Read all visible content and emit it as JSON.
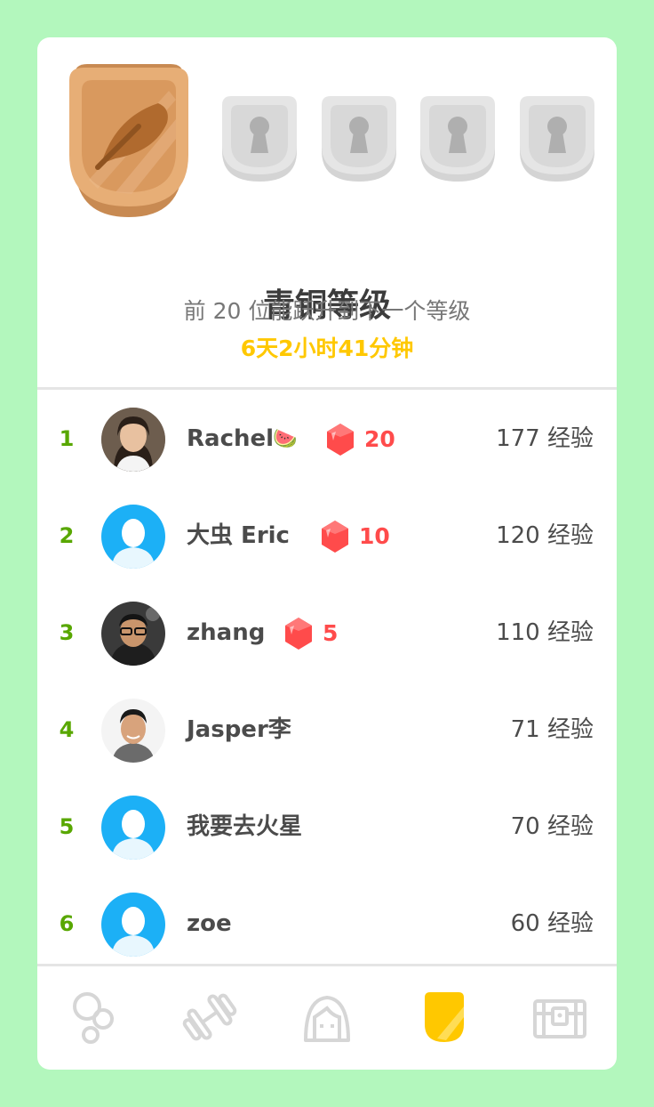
{
  "league": {
    "title": "青铜等级",
    "subtitle": "前 20 位能跃升到下一个等级",
    "timer": "6天2小时41分钟"
  },
  "leaderboard": [
    {
      "rank": "1",
      "name": "Rachel",
      "emoji": "🍉",
      "gems": "20",
      "xp": "177 经验",
      "avatar": "photo"
    },
    {
      "rank": "2",
      "name": "大虫 Eric",
      "emoji": "",
      "gems": "10",
      "xp": "120 经验",
      "avatar": "default"
    },
    {
      "rank": "3",
      "name": "zhang",
      "emoji": "",
      "gems": "5",
      "xp": "110 经验",
      "avatar": "photo"
    },
    {
      "rank": "4",
      "name": "Jasper李",
      "emoji": "",
      "gems": "",
      "xp": "71 经验",
      "avatar": "photo"
    },
    {
      "rank": "5",
      "name": "我要去火星",
      "emoji": "",
      "gems": "",
      "xp": "70 经验",
      "avatar": "default"
    },
    {
      "rank": "6",
      "name": "zoe",
      "emoji": "",
      "gems": "",
      "xp": "60 经验",
      "avatar": "default"
    }
  ],
  "nav": {
    "items": [
      {
        "icon": "learn-icon",
        "active": false
      },
      {
        "icon": "practice-dumbbell-icon",
        "active": false
      },
      {
        "icon": "profile-icon",
        "active": false
      },
      {
        "icon": "leaderboard-shield-icon",
        "active": true
      },
      {
        "icon": "shop-chest-icon",
        "active": false
      }
    ]
  },
  "colors": {
    "background": "#b3f7bd",
    "rank": "#58a700",
    "timer": "#ffc800",
    "gem": "#ff4b4b",
    "bronze": "#e0a26d",
    "nav_active": "#ffc800",
    "nav_inactive": "#d6d6d6"
  }
}
